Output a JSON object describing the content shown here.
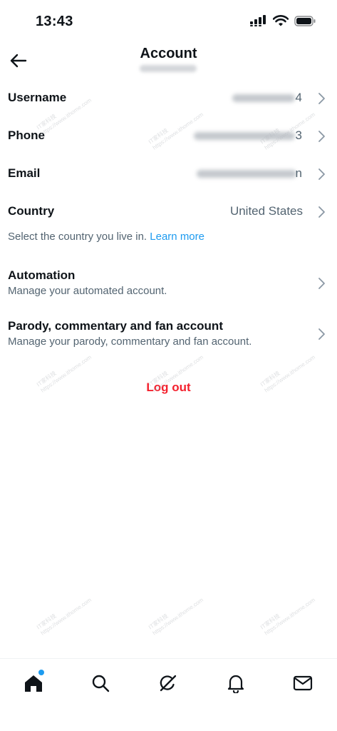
{
  "status_bar": {
    "time": "13:43"
  },
  "header": {
    "title": "Account"
  },
  "rows": {
    "username": {
      "label": "Username",
      "value_tail": "4"
    },
    "phone": {
      "label": "Phone",
      "value_tail": "3"
    },
    "email": {
      "label": "Email",
      "value_tail": "n"
    },
    "country": {
      "label": "Country",
      "value": "United States"
    }
  },
  "country_help": {
    "text": "Select the country you live in.",
    "link": "Learn more"
  },
  "automation": {
    "label": "Automation",
    "description": "Manage your automated account."
  },
  "parody": {
    "label": "Parody, commentary and fan account",
    "description": "Manage your parody, commentary and fan account."
  },
  "logout_label": "Log out",
  "watermark": {
    "line1": "IT家科技",
    "line2": "https://www.ithome.com"
  },
  "colors": {
    "accent": "#1d9bf0",
    "danger": "#f4212e",
    "secondary_text": "#536471"
  },
  "tabs": [
    {
      "icon": "home-icon"
    },
    {
      "icon": "search-icon"
    },
    {
      "icon": "grok-icon"
    },
    {
      "icon": "notifications-icon"
    },
    {
      "icon": "messages-icon"
    }
  ]
}
